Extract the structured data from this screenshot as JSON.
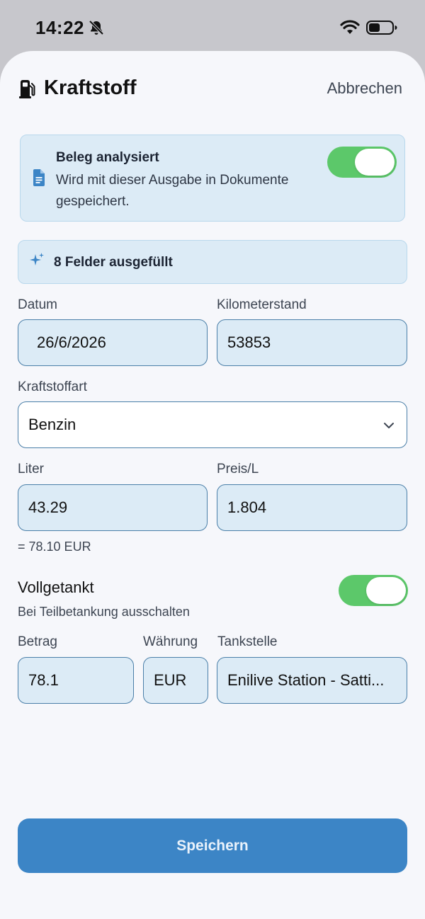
{
  "status_bar": {
    "time": "14:22"
  },
  "header": {
    "title": "Kraftstoff",
    "cancel_label": "Abbrechen"
  },
  "receipt": {
    "title": "Beleg analysiert",
    "description": "Wird mit dieser Ausgabe in Dokumente gespeichert.",
    "toggle_on": true
  },
  "autofill": {
    "text": "8 Felder ausgefüllt"
  },
  "form": {
    "date_label": "Datum",
    "date_value": "26/6/2026",
    "odometer_label": "Kilometerstand",
    "odometer_value": "53853",
    "fuel_type_label": "Kraftstoffart",
    "fuel_type_value": "Benzin",
    "liters_label": "Liter",
    "liters_value": "43.29",
    "price_label": "Preis/L",
    "price_value": "1.804",
    "calc_text": "= 78.10 EUR",
    "full_tank_label": "Vollgetankt",
    "full_tank_hint": "Bei Teilbetankung ausschalten",
    "full_tank_on": true,
    "amount_label": "Betrag",
    "amount_value": "78.1",
    "currency_label": "Währung",
    "currency_value": "EUR",
    "station_label": "Tankstelle",
    "station_value": "Enilive Station - Satti..."
  },
  "save_label": "Speichern",
  "colors": {
    "accent": "#3c85c6",
    "toggle_on": "#5cc86a",
    "field_bg": "#dcebf6",
    "field_border": "#4a7fa8"
  },
  "icons": [
    "bell-slash-icon",
    "wifi-icon",
    "battery-icon",
    "fuel-pump-icon",
    "document-icon",
    "sparkle-icon",
    "chevron-down-icon"
  ]
}
